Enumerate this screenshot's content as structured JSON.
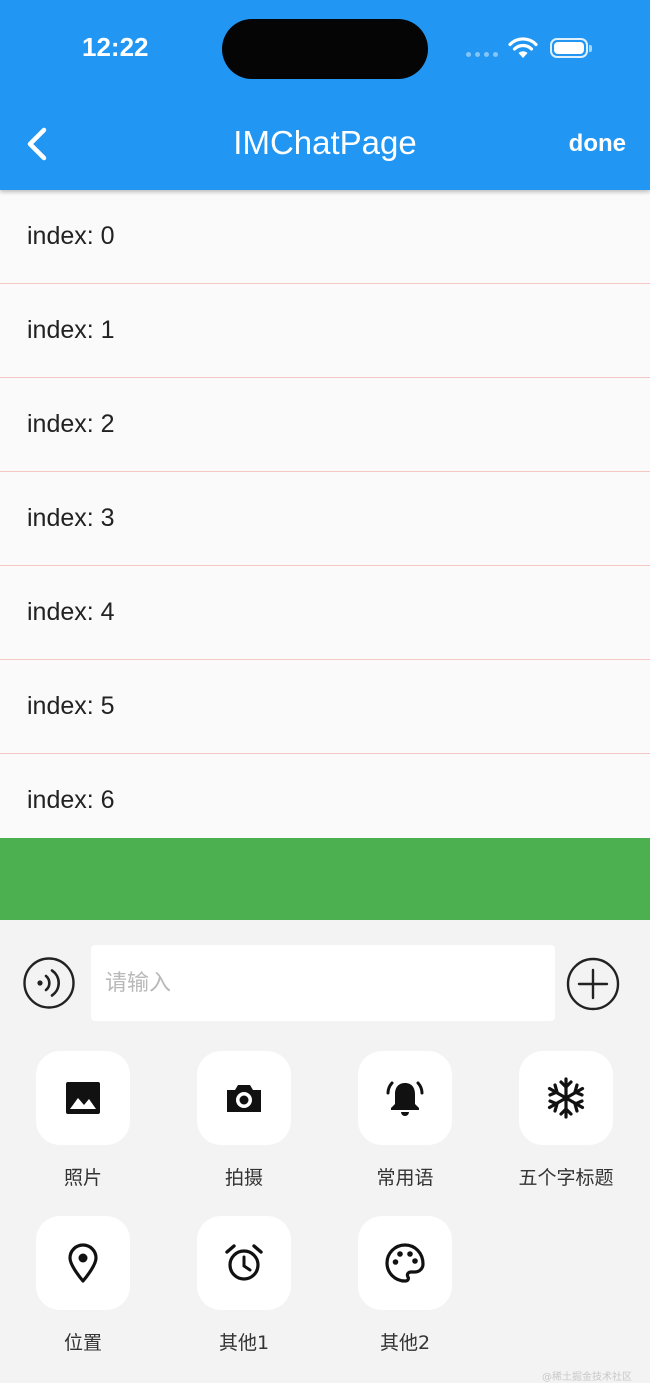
{
  "status_bar": {
    "time": "12:22"
  },
  "app_bar": {
    "title": "IMChatPage",
    "action_label": "done",
    "color": "#2196f3"
  },
  "list": {
    "items": [
      "index: 0",
      "index: 1",
      "index: 2",
      "index: 3",
      "index: 4",
      "index: 5",
      "index: 6"
    ],
    "divider_color": "#f4c7c3"
  },
  "green_panel": {
    "color": "#4caf50"
  },
  "input_bar": {
    "placeholder": "请输入",
    "value": ""
  },
  "panel": {
    "tiles": [
      {
        "label": "照片",
        "icon": "photo-icon"
      },
      {
        "label": "拍摄",
        "icon": "camera-icon"
      },
      {
        "label": "常用语",
        "icon": "bell-icon"
      },
      {
        "label": "五个字标题",
        "icon": "snowflake-icon"
      },
      {
        "label": "位置",
        "icon": "location-pin-icon"
      },
      {
        "label": "其他1",
        "icon": "alarm-clock-icon"
      },
      {
        "label": "其他2",
        "icon": "palette-icon"
      }
    ]
  },
  "watermark": "@稀土掘金技术社区"
}
